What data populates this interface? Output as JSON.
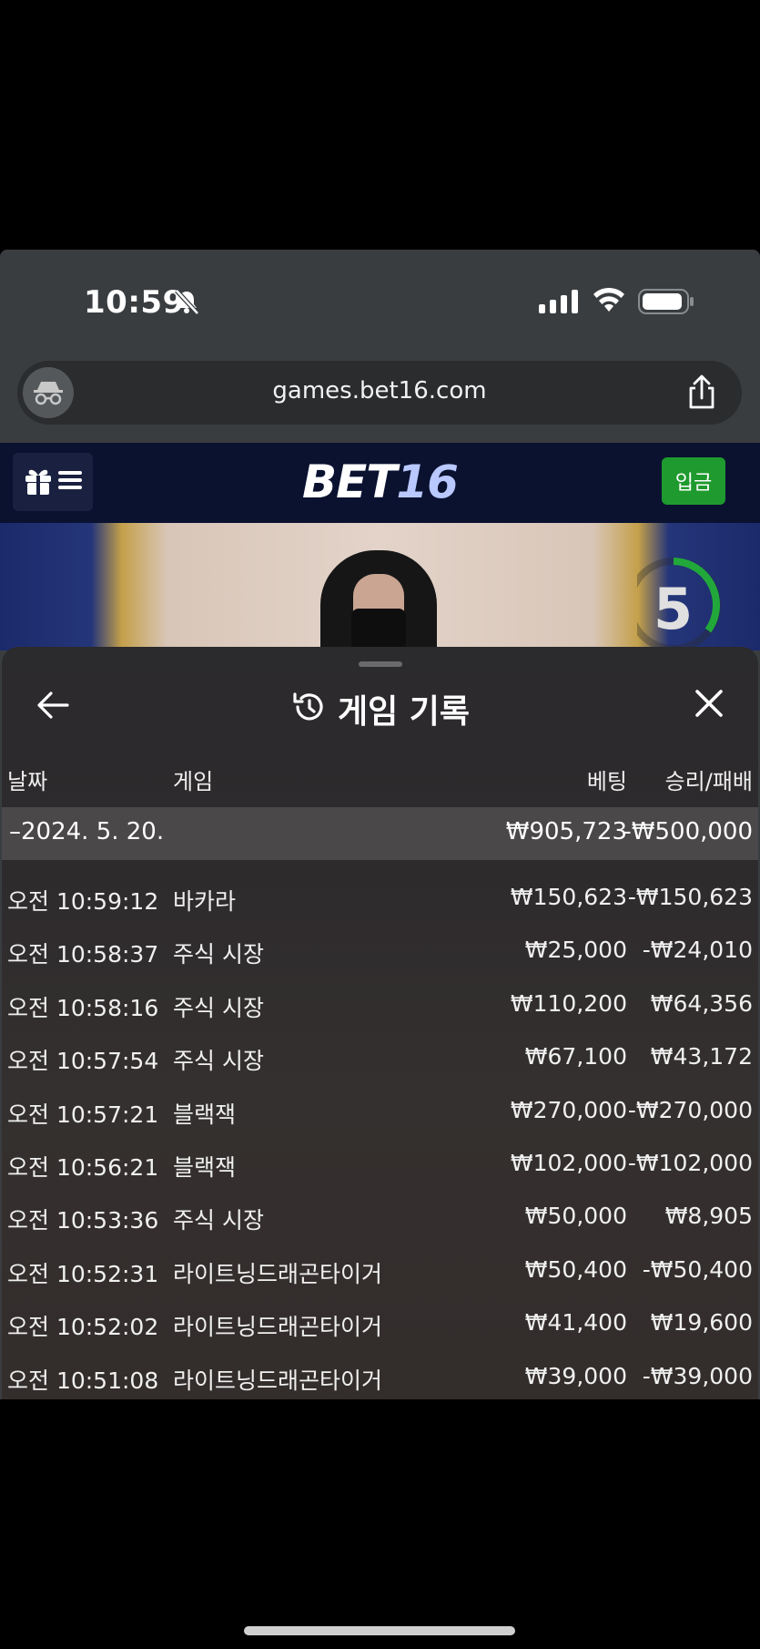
{
  "status_bar": {
    "time": "10:59"
  },
  "browser": {
    "url": "games.bet16.com"
  },
  "header": {
    "logo_main": "BET",
    "logo_num": "16",
    "deposit_label": "입금"
  },
  "video": {
    "countdown": "5"
  },
  "panel": {
    "title": "게임 기록",
    "columns": {
      "date": "날짜",
      "game": "게임",
      "bet": "베팅",
      "result": "승리/패배"
    },
    "summary": {
      "date": "–2024. 5. 20.",
      "bet": "₩905,723",
      "result": "-₩500,000"
    },
    "rows": [
      {
        "time": "오전 10:59:12",
        "game": "바카라",
        "bet": "₩150,623",
        "result": "-₩150,623"
      },
      {
        "time": "오전 10:58:37",
        "game": "주식 시장",
        "bet": "₩25,000",
        "result": "-₩24,010"
      },
      {
        "time": "오전 10:58:16",
        "game": "주식 시장",
        "bet": "₩110,200",
        "result": "₩64,356"
      },
      {
        "time": "오전 10:57:54",
        "game": "주식 시장",
        "bet": "₩67,100",
        "result": "₩43,172"
      },
      {
        "time": "오전 10:57:21",
        "game": "블랙잭",
        "bet": "₩270,000",
        "result": "-₩270,000"
      },
      {
        "time": "오전 10:56:21",
        "game": "블랙잭",
        "bet": "₩102,000",
        "result": "-₩102,000"
      },
      {
        "time": "오전 10:53:36",
        "game": "주식 시장",
        "bet": "₩50,000",
        "result": "₩8,905"
      },
      {
        "time": "오전 10:52:31",
        "game": "라이트닝드래곤타이거",
        "bet": "₩50,400",
        "result": "-₩50,400"
      },
      {
        "time": "오전 10:52:02",
        "game": "라이트닝드래곤타이거",
        "bet": "₩41,400",
        "result": "₩19,600"
      },
      {
        "time": "오전 10:51:08",
        "game": "라이트닝드래곤타이거",
        "bet": "₩39,000",
        "result": "-₩39,000"
      }
    ]
  },
  "colors": {
    "deposit": "#1f9a2e",
    "header_bg": "#0a1230",
    "timer_ring": "#22a83a"
  },
  "icons": [
    "bell-slash-icon",
    "signal-icon",
    "wifi-icon",
    "battery-icon",
    "incognito-icon",
    "share-icon",
    "gift-icon",
    "hamburger-icon",
    "back-arrow-icon",
    "history-icon",
    "close-icon"
  ]
}
